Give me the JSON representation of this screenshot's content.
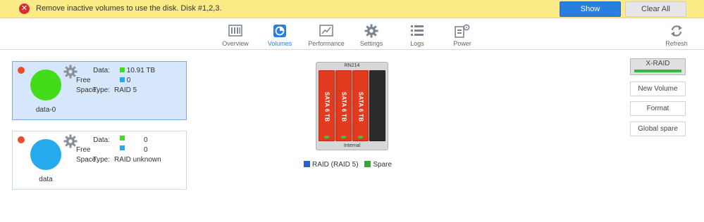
{
  "alert": {
    "message": "Remove inactive volumes to use the disk. Disk #1,2,3.",
    "show_label": "Show",
    "clear_all_label": "Clear All"
  },
  "nav": {
    "items": [
      {
        "label": "Overview",
        "icon": "overview-icon"
      },
      {
        "label": "Volumes",
        "icon": "volumes-icon",
        "active": true
      },
      {
        "label": "Performance",
        "icon": "performance-icon"
      },
      {
        "label": "Settings",
        "icon": "settings-icon"
      },
      {
        "label": "Logs",
        "icon": "logs-icon"
      },
      {
        "label": "Power",
        "icon": "power-icon"
      }
    ],
    "refresh_label": "Refresh"
  },
  "volumes": [
    {
      "name": "data-0",
      "selected": true,
      "color": "#44db1b",
      "data_label": "Data:",
      "data_value": "10.91 TB",
      "free_label": "Free Space:",
      "free_value": "0",
      "type_label": "Type:",
      "type_value": "RAID 5"
    },
    {
      "name": "data",
      "selected": false,
      "color": "#27a9ee",
      "data_label": "Data:",
      "data_value": "0",
      "free_label": "Free Space:",
      "free_value": "0",
      "type_label": "Type:",
      "type_value": "RAID unknown"
    }
  ],
  "chassis": {
    "model": "RN214",
    "location": "Internal",
    "disks": [
      "SATA 6 TB",
      "SATA 6 TB",
      "SATA 6 TB"
    ]
  },
  "legend": {
    "raid_label": "RAID (RAID 5)",
    "raid_color": "#2b62c9",
    "spare_label": "Spare",
    "spare_color": "#3aa53a"
  },
  "actions": {
    "xraid": "X-RAID",
    "new_volume": "New Volume",
    "format": "Format",
    "global_spare": "Global spare"
  },
  "colors": {
    "data_swatch": "#44db1b",
    "free_swatch": "#27a9ee",
    "status_dot": "#ea4e28"
  }
}
